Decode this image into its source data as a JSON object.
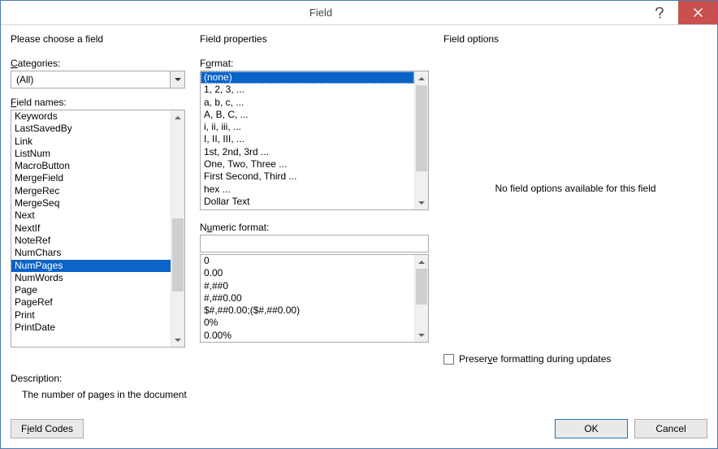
{
  "window": {
    "title": "Field"
  },
  "left": {
    "section": "Please choose a field",
    "categories_label_pre": "C",
    "categories_label_rest": "ategories:",
    "categories_value": "(All)",
    "field_names_label_pre": "F",
    "field_names_label_rest": "ield names:",
    "items": [
      "Keywords",
      "LastSavedBy",
      "Link",
      "ListNum",
      "MacroButton",
      "MergeField",
      "MergeRec",
      "MergeSeq",
      "Next",
      "NextIf",
      "NoteRef",
      "NumChars",
      "NumPages",
      "NumWords",
      "Page",
      "PageRef",
      "Print",
      "PrintDate"
    ],
    "selected_index": 12
  },
  "mid": {
    "section": "Field properties",
    "format_label_pre": "F",
    "format_label_post": "o",
    "format_label_rest": "rmat:",
    "format_items": [
      "(none)",
      "1, 2, 3, ...",
      "a, b, c, ...",
      "A, B, C, ...",
      "i, ii, iii, ...",
      "I, II, III, ...",
      "1st, 2nd, 3rd ...",
      "One, Two, Three ...",
      "First Second, Third ...",
      "hex ...",
      "Dollar Text"
    ],
    "format_selected_index": 0,
    "numeric_label_pre": "N",
    "numeric_label_post": "u",
    "numeric_label_rest": "meric format:",
    "numeric_value": "",
    "numeric_items": [
      "0",
      "0.00",
      "#,##0",
      "#,##0.00",
      "$#,##0.00;($#,##0.00)",
      "0%",
      "0.00%"
    ]
  },
  "right": {
    "section": "Field options",
    "no_options": "No field options available for this field",
    "preserve_label_pre": "Preser",
    "preserve_label_u": "v",
    "preserve_label_rest": "e formatting during updates"
  },
  "description": {
    "label": "Description:",
    "text": "The number of pages in the document"
  },
  "buttons": {
    "field_codes_pre": "F",
    "field_codes_u": "i",
    "field_codes_rest": "eld Codes",
    "ok": "OK",
    "cancel": "Cancel"
  }
}
